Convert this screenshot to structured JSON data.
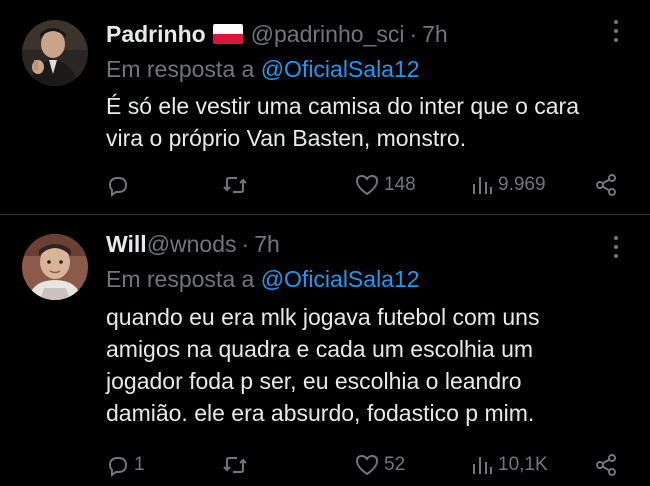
{
  "tweets": [
    {
      "name": "Padrinho",
      "flag": "polish-flag",
      "handle": "@padrinho_sci",
      "separator": "·",
      "time": "7h",
      "reply_prefix": "Em resposta a",
      "reply_mention": "@OficialSala12",
      "text_lines": [
        "É só ele vestir uma camisa do inter que o cara",
        "vira o próprio Van Basten, monstro."
      ],
      "replies": "",
      "retweets": "",
      "likes": "148",
      "views": "9.969"
    },
    {
      "name": "Will",
      "handle": "@wnods",
      "separator": "·",
      "time": "7h",
      "reply_prefix": "Em resposta a",
      "reply_mention": "@OficialSala12",
      "text_lines": [
        "quando eu era mlk jogava futebol com uns",
        "amigos na quadra e cada um escolhia um",
        "jogador foda p ser, eu escolhia o leandro",
        "damião. ele era absurdo, fodastico p mim."
      ],
      "replies": "1",
      "retweets": "",
      "likes": "52",
      "views": "10,1K"
    }
  ],
  "colors": {
    "background": "#000000",
    "text": "#e7e9ea",
    "muted": "#71767b",
    "link": "#1d9bf0",
    "divider": "#2f3336"
  },
  "icons": {
    "reply": "reply-icon",
    "retweet": "retweet-icon",
    "like": "heart-icon",
    "views": "views-icon",
    "share": "share-icon",
    "more": "more-icon"
  }
}
